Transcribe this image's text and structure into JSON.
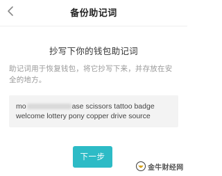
{
  "header": {
    "back_icon": "chevron-left-icon",
    "title": "备份助记词"
  },
  "main": {
    "subtitle": "抄写下你的钱包助记词",
    "description": "助记词用于恢复钱包，将它抄写下来，并存放在安全的地方。",
    "mnemonic": {
      "prefix": "mo",
      "suffix_line1": "ase scissors tattoo badge",
      "line2": "welcome lottery pony copper drive source"
    },
    "next_button_label": "下一步"
  },
  "watermark": {
    "text": "金牛财经网",
    "logo_icon": "bull-logo-icon"
  },
  "colors": {
    "accent": "#2dbbc6",
    "mnemonic_bg": "#f3f3f3",
    "muted_text": "#9a9a9a"
  }
}
